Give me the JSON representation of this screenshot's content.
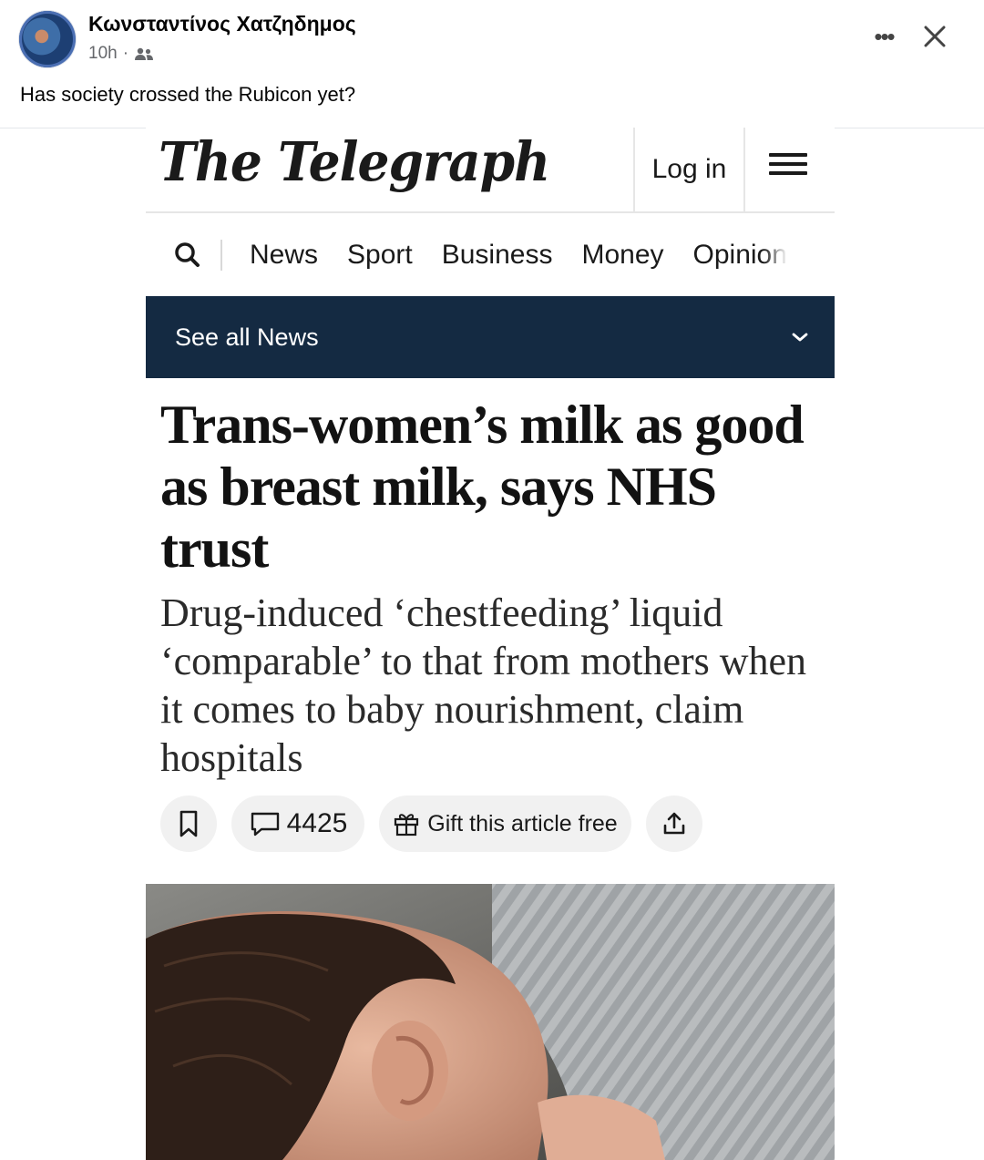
{
  "post": {
    "author_name": "Κωνσταντίνος Χατζηδημος",
    "timestamp": "10h",
    "separator": "·",
    "audience_icon": "friends-icon",
    "caption": "Has society crossed the Rubicon yet?",
    "more_icon": "more-options-icon",
    "close_icon": "close-icon"
  },
  "article": {
    "logo": "The Telegraph",
    "login_label": "Log in",
    "menu_icon": "hamburger-menu-icon",
    "nav": {
      "search_icon": "search-icon",
      "items": [
        "News",
        "Sport",
        "Business",
        "Money",
        "Opinion"
      ]
    },
    "section_bar": {
      "label": "See all News",
      "background": "#142a42"
    },
    "headline": "Trans-women’s milk as good as breast milk, says NHS trust",
    "standfirst": "Drug-induced ‘chestfeeding’ liquid ‘comparable’ to that from mothers when it comes to baby nourishment, claim hospitals",
    "actions": {
      "comment_count": "4425",
      "gift_label": "Gift this article free"
    },
    "hero_image": {
      "description_icon": "photo-baby-breastfeeding"
    }
  }
}
